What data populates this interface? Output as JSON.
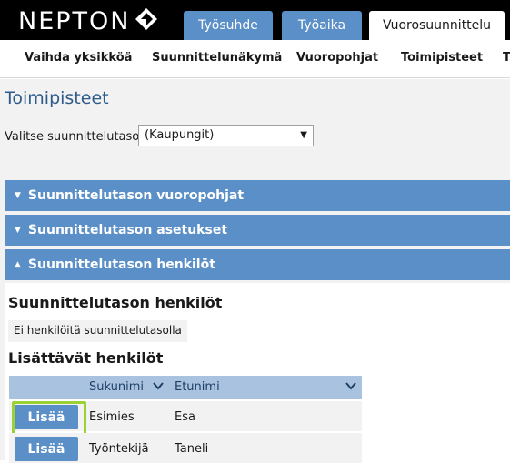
{
  "header": {
    "logo_text": "NEPTON",
    "tabs": [
      {
        "label": "Työsuhde",
        "active": false
      },
      {
        "label": "Työaika",
        "active": false
      },
      {
        "label": "Vuorosuunnittelu",
        "active": true
      }
    ]
  },
  "subnav": {
    "items": [
      "Vaihda yksikköä",
      "Suunnittelunäkymä",
      "Vuoropohjat",
      "Toimipisteet",
      "T"
    ]
  },
  "page": {
    "title": "Toimipisteet",
    "level_label": "Valitse suunnittelutaso:",
    "level_value": "(Kaupungit)"
  },
  "accordions": [
    {
      "label": "Suunnittelutason vuoropohjat",
      "expanded": false
    },
    {
      "label": "Suunnittelutason asetukset",
      "expanded": false
    },
    {
      "label": "Suunnittelutason henkilöt",
      "expanded": true
    }
  ],
  "persons_panel": {
    "current_heading": "Suunnittelutason henkilöt",
    "empty_note": "Ei henkilöitä suunnittelutasolla",
    "addable_heading": "Lisättävät henkilöt",
    "columns": [
      "Sukunimi",
      "Etunimi"
    ],
    "rows": [
      {
        "action": "Lisää",
        "last_name": "Esimies",
        "first_name": "Esa"
      },
      {
        "action": "Lisää",
        "last_name": "Työntekijä",
        "first_name": "Taneli"
      }
    ]
  },
  "colors": {
    "accent_blue": "#5b8fc7",
    "table_header": "#a9c2e0",
    "title_blue": "#2f5b8a",
    "highlight_green": "#9ad233"
  },
  "icons": {
    "logo_mark": "nepton-logo-icon",
    "select_arrow": "chevron-down-icon",
    "accordion_collapsed": "triangle-down-icon",
    "accordion_expanded": "triangle-up-icon",
    "sort": "sort-chevron-icon"
  }
}
